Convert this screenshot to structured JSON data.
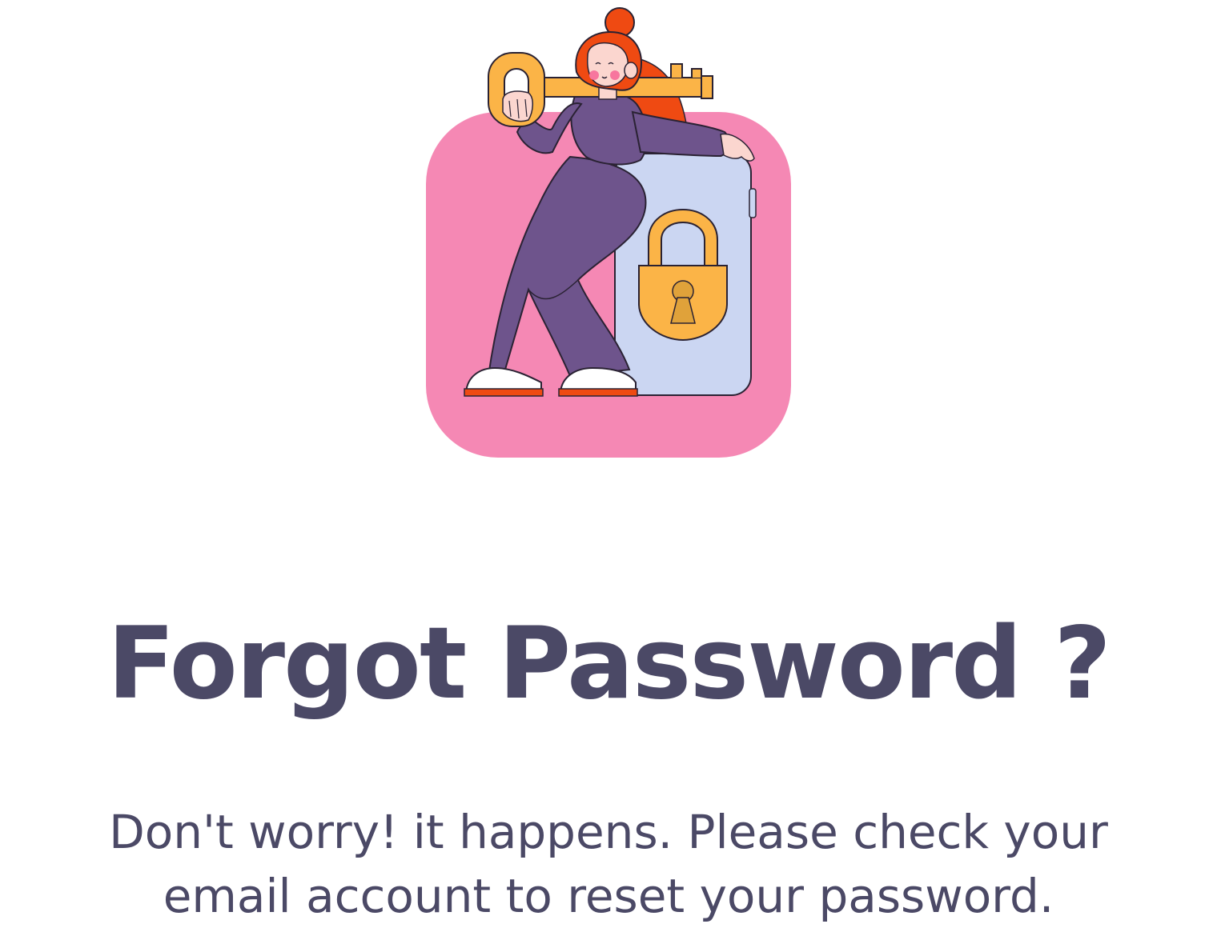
{
  "illustration": {
    "name": "woman-with-key-and-padlock",
    "colors": {
      "card": "#f588b4",
      "phone": "#cbd6f2",
      "key": "#fbb447",
      "outfit": "#6e548c",
      "hair": "#ef4a12",
      "skin": "#fbd6cf"
    }
  },
  "title": "Forgot Password ?",
  "message": {
    "line1": "Don't worry! it happens. Please check your",
    "line2": "email account to reset your password."
  },
  "colors": {
    "text": "#4b4966",
    "background": "#ffffff"
  }
}
